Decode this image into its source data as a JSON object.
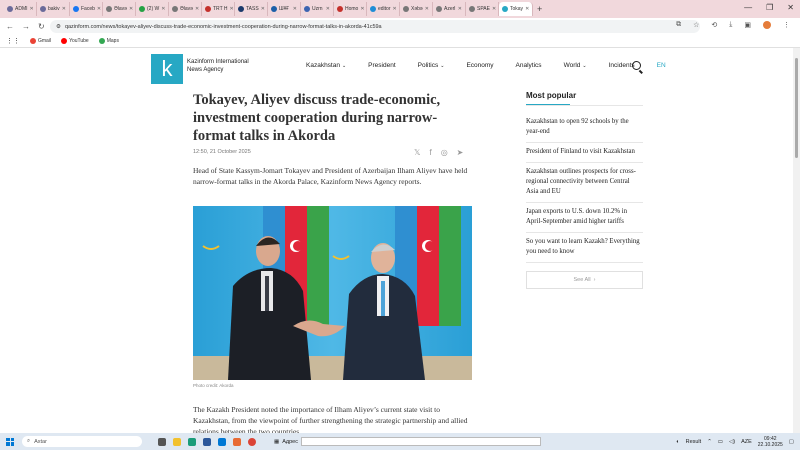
{
  "browser": {
    "tabs": [
      {
        "label": "ADMI",
        "color": "#6a6a9a"
      },
      {
        "label": "bakiv",
        "color": "#6a6a9a"
      },
      {
        "label": "Faceb",
        "color": "#1877f2"
      },
      {
        "label": "Əlavə",
        "color": "#777777"
      },
      {
        "label": "(2) W",
        "color": "#25a244"
      },
      {
        "label": "Əlavə",
        "color": "#777777"
      },
      {
        "label": "TRT H",
        "color": "#c4302b"
      },
      {
        "label": "TASS",
        "color": "#1b3a6b"
      },
      {
        "label": "ШҰҒ",
        "color": "#1b5fa8"
      },
      {
        "label": "Uzrn",
        "color": "#3c64b1"
      },
      {
        "label": "Homo",
        "color": "#c4302b"
      },
      {
        "label": "editor",
        "color": "#1f8dd6"
      },
      {
        "label": "Xəbə",
        "color": "#777777"
      },
      {
        "label": "Azerl",
        "color": "#777777"
      },
      {
        "label": "SPAE",
        "color": "#777777"
      },
      {
        "label": "Tokay",
        "color": "#27a8c4"
      }
    ],
    "new_tab": "+",
    "url": "qazinform.com/news/tokayev-aliyev-discuss-trade-economic-investment-cooperation-during-narrow-format-talks-in-akorda-41c59a",
    "bookmarks": [
      {
        "label": "Gmail",
        "color": "#ea4335"
      },
      {
        "label": "YouTube",
        "color": "#ff0000"
      },
      {
        "label": "Maps",
        "color": "#34a853"
      }
    ]
  },
  "site": {
    "logo_letter": "k",
    "brand_line1": "Kazinform International",
    "brand_line2": "News Agency",
    "menu": [
      "Kazakhstan",
      "President",
      "Politics",
      "Economy",
      "Analytics",
      "World",
      "Incidents"
    ],
    "menu_dropdowns": [
      true,
      false,
      true,
      false,
      false,
      true,
      false
    ],
    "lang": "EN"
  },
  "article": {
    "title": "Tokayev, Aliyev discuss trade-economic, investment cooperation during narrow-format talks in Akorda",
    "date": "12:50, 21 October 2025",
    "lead": "Head of State Kassym-Jomart Tokayev and President of Azerbaijan Ilham Aliyev have held narrow-format talks in the Akorda Palace, Kazinform News Agency reports.",
    "photo_caption": "Photo credit: Akorda",
    "body": "The Kazakh President noted the importance of Ilham Aliyev’s current state visit to Kazakhstan, from the viewpoint of further strengthening the strategic partnership and allied relations between the two countries."
  },
  "most_popular": {
    "heading": "Most popular",
    "items": [
      "Kazakhstan to open 92 schools by the year-end",
      "President of Finland to visit Kazakhstan",
      "Kazakhstan outlines prospects for cross-regional connectivity between Central Asia and EU",
      "Japan exports to U.S. down 10.2% in April-September amid higher tariffs",
      "So you want to learn Kazakh? Everything you need to know"
    ],
    "see_all": "See All"
  },
  "taskbar": {
    "search_placeholder": "Axtar",
    "address_label": "Адрес",
    "result_label": "Result",
    "lang": "AZE",
    "time": "09:42",
    "date": "22.10.2025"
  },
  "colors": {
    "accent": "#27a8c4",
    "kz_flag": "#2a9fd6",
    "az_blue": "#2f8fd1",
    "az_red": "#e2263a",
    "az_green": "#3aa34a"
  }
}
